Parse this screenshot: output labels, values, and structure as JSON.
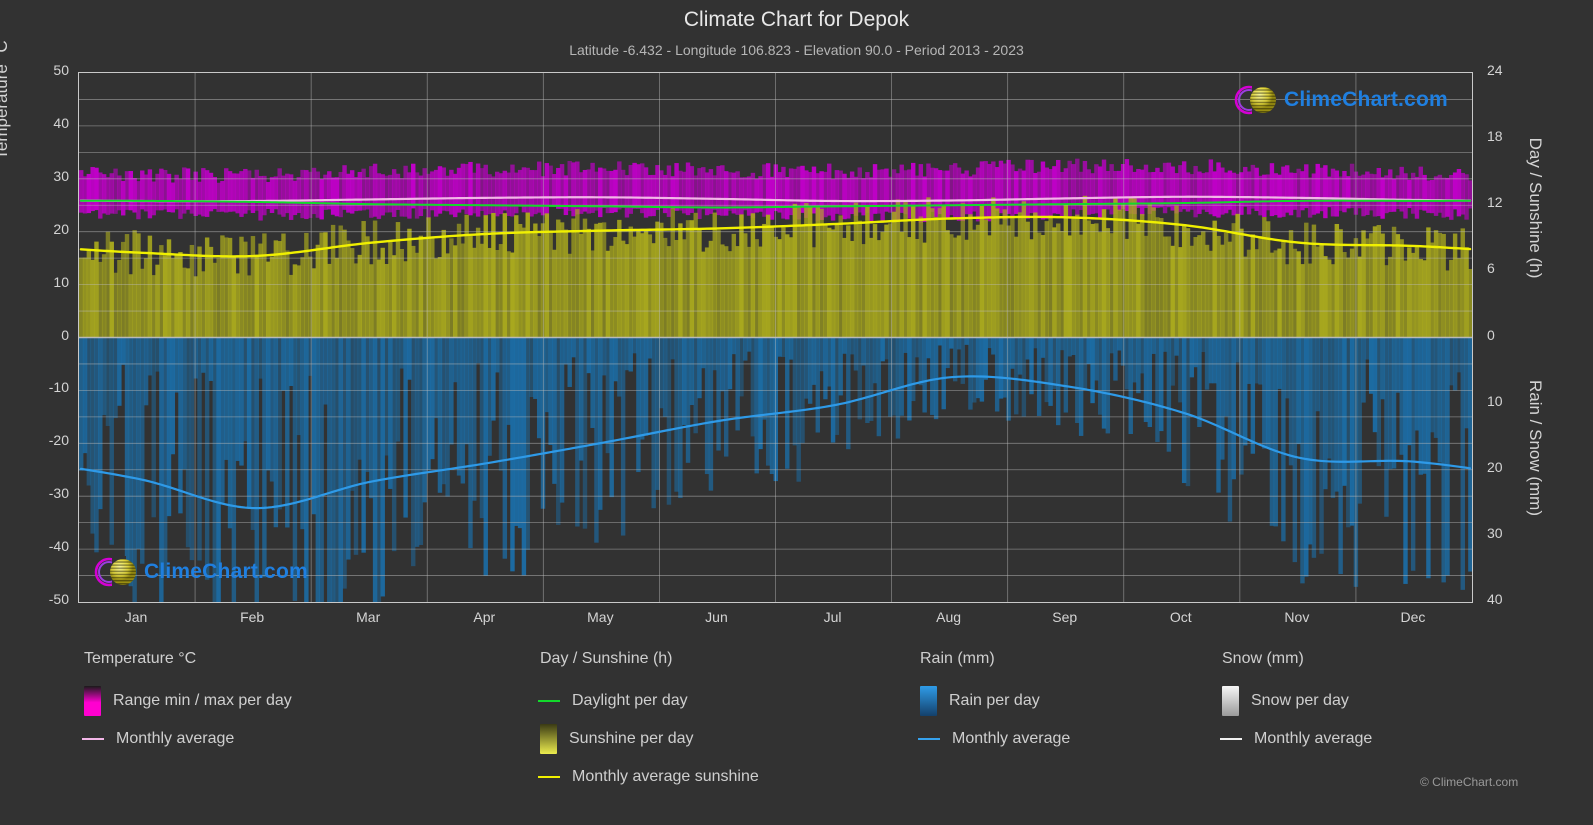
{
  "header": {
    "title": "Climate Chart for Depok",
    "subtitle": "Latitude -6.432 - Longitude 106.823 - Elevation 90.0 - Period 2013 - 2023"
  },
  "axes": {
    "left_label": "Temperature °C",
    "right_top_label": "Day / Sunshine (h)",
    "right_bottom_label": "Rain / Snow (mm)",
    "left_ticks": [
      50,
      40,
      30,
      20,
      10,
      0,
      -10,
      -20,
      -30,
      -40,
      -50
    ],
    "right_ticks": [
      "24",
      "18",
      "12",
      "6",
      "0",
      "10",
      "20",
      "30",
      "40"
    ],
    "x_ticks": [
      "Jan",
      "Feb",
      "Mar",
      "Apr",
      "May",
      "Jun",
      "Jul",
      "Aug",
      "Sep",
      "Oct",
      "Nov",
      "Dec"
    ]
  },
  "legend": {
    "columns": [
      {
        "title": "Temperature °C",
        "entries": [
          {
            "label": "Range min / max per day",
            "marker": "swatch",
            "color": "#ff00d0"
          },
          {
            "label": "Monthly average",
            "marker": "line",
            "color": "#f3b6e8"
          }
        ]
      },
      {
        "title": "Day / Sunshine (h)",
        "entries": [
          {
            "label": "Daylight per day",
            "marker": "line",
            "color": "#12d92b"
          },
          {
            "label": "Sunshine per day",
            "marker": "swatch",
            "color": "#e8e83c"
          },
          {
            "label": "Monthly average sunshine",
            "marker": "line",
            "color": "#f0f000"
          }
        ]
      },
      {
        "title": "Rain (mm)",
        "entries": [
          {
            "label": "Rain per day",
            "marker": "swatch",
            "color": "#1f8fe0"
          },
          {
            "label": "Monthly average",
            "marker": "line",
            "color": "#36a2ee"
          }
        ]
      },
      {
        "title": "Snow (mm)",
        "entries": [
          {
            "label": "Snow per day",
            "marker": "swatch",
            "color": "#f0f0f0"
          },
          {
            "label": "Monthly average",
            "marker": "line",
            "color": "#f0f0f0"
          }
        ]
      }
    ]
  },
  "watermark": {
    "text": "ClimeChart.com"
  },
  "footer": {
    "copyright": "© ClimeChart.com"
  },
  "chart_data": {
    "type": "area",
    "title": "Climate Chart for Depok",
    "subtitle": "Latitude -6.432 - Longitude 106.823 - Elevation 90.0 - Period 2013 - 2023",
    "xlabel": "",
    "ylabel": "Temperature °C",
    "ylim": [
      -50,
      50
    ],
    "y2_top_label": "Day / Sunshine (h)",
    "y2_top_lim": [
      0,
      24
    ],
    "y2_bottom_label": "Rain / Snow (mm)",
    "y2_bottom_lim": [
      0,
      40
    ],
    "grid": true,
    "legend_position": "below",
    "categories": [
      "Jan",
      "Feb",
      "Mar",
      "Apr",
      "May",
      "Jun",
      "Jul",
      "Aug",
      "Sep",
      "Oct",
      "Nov",
      "Dec"
    ],
    "series": [
      {
        "name": "Range min / max per day",
        "type": "band",
        "unit": "°C",
        "color": "#ff00d0",
        "min_values": [
          23.2,
          23.2,
          23.4,
          23.6,
          23.7,
          23.2,
          22.8,
          22.8,
          23.2,
          23.6,
          23.6,
          23.4
        ],
        "max_values": [
          30.8,
          30.8,
          31.4,
          31.8,
          31.9,
          31.6,
          31.4,
          31.8,
          32.4,
          32.4,
          31.8,
          31.2
        ]
      },
      {
        "name": "Monthly average temperature",
        "type": "line",
        "unit": "°C",
        "color": "#f3b6e8",
        "values": [
          25.8,
          25.8,
          26.1,
          26.4,
          26.5,
          26.2,
          25.8,
          25.9,
          26.3,
          26.6,
          26.4,
          26.0
        ]
      },
      {
        "name": "Daylight per day",
        "type": "line",
        "unit": "h",
        "color": "#12d92b",
        "values": [
          12.4,
          12.3,
          12.1,
          12.0,
          11.9,
          11.8,
          11.9,
          12.0,
          12.1,
          12.2,
          12.4,
          12.4
        ]
      },
      {
        "name": "Sunshine per day",
        "type": "area",
        "unit": "h",
        "color": "#e8e83c",
        "values": [
          7.7,
          7.4,
          8.6,
          9.4,
          9.7,
          9.9,
          10.3,
          10.8,
          10.9,
          10.2,
          8.6,
          8.3
        ]
      },
      {
        "name": "Monthly average sunshine",
        "type": "line",
        "unit": "h",
        "color": "#f0f000",
        "values": [
          7.7,
          7.4,
          8.6,
          9.4,
          9.7,
          9.9,
          10.3,
          10.8,
          10.9,
          10.2,
          8.6,
          8.3
        ]
      },
      {
        "name": "Rain monthly average",
        "type": "line",
        "unit": "mm",
        "color": "#36a2ee",
        "values": [
          21.4,
          25.8,
          21.8,
          19.0,
          15.9,
          12.6,
          10.2,
          6.0,
          7.4,
          11.4,
          18.2,
          18.8
        ]
      },
      {
        "name": "Snow monthly average",
        "type": "line",
        "unit": "mm",
        "color": "#f0f0f0",
        "values": [
          0,
          0,
          0,
          0,
          0,
          0,
          0,
          0,
          0,
          0,
          0,
          0
        ]
      }
    ]
  }
}
